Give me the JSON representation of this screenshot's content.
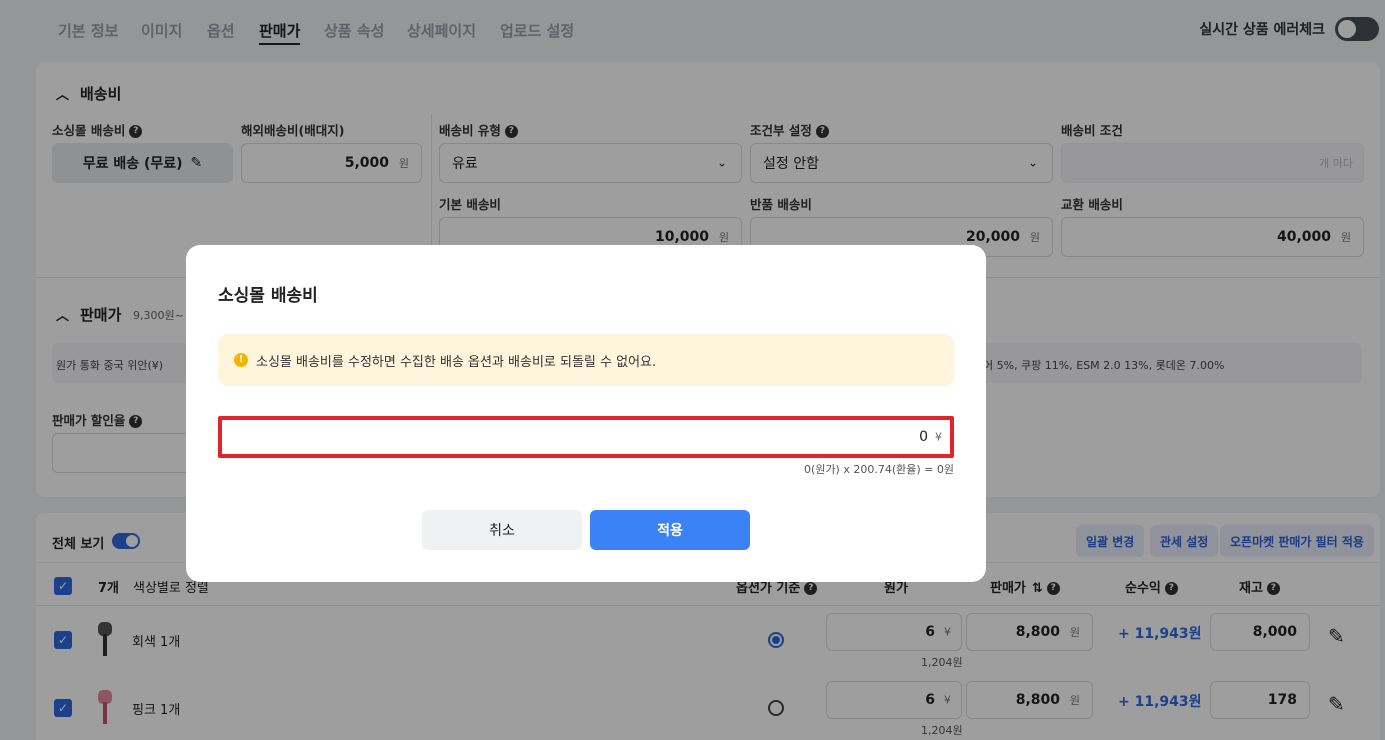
{
  "tabs": [
    "기본 정보",
    "이미지",
    "옵션",
    "판매가",
    "상품 속성",
    "상세페이지",
    "업로드 설정"
  ],
  "active_tab": "판매가",
  "realtime_check": {
    "label": "실시간 상품 에러체크",
    "enabled": false
  },
  "shipping": {
    "title": "배송비",
    "sourcing_fee_label": "소싱몰 배송비",
    "sourcing_fee_value": "무료 배송 (무료)",
    "overseas_label": "해외배송비(배대지)",
    "overseas_value": "5,000",
    "type_label": "배송비 유형",
    "type_value": "유료",
    "conditional_label": "조건부 설정",
    "conditional_value": "설정 안함",
    "condition_label": "배송비 조건",
    "condition_placeholder": "개 마다",
    "base_label": "기본 배송비",
    "base_value": "10,000",
    "return_label": "반품 배송비",
    "return_value": "20,000",
    "exchange_label": "교환 배송비",
    "exchange_value": "40,000",
    "unit": "원"
  },
  "price": {
    "title": "판매가",
    "range": "9,300원~",
    "currency_label": "원가 통화 중국 위안(¥)",
    "fees_text": "어 5%, 쿠팡 11%, ESM 2.0 13%, 롯데온 7.00%",
    "discount_label": "판매가 할인율"
  },
  "list": {
    "view_all_label": "전체 보기",
    "count": "7개",
    "sort_label": "색상별로 정렬",
    "buttons": [
      "일괄 변경",
      "관세 설정",
      "오픈마켓 판매가 필터 적용"
    ],
    "headers": {
      "base_option": "옵션가 기준",
      "cost": "원가",
      "price": "판매가",
      "profit": "순수익",
      "stock": "재고"
    },
    "rows": [
      {
        "name": "회색 1개",
        "cost": "6",
        "cost_krw": "1,204원",
        "price": "8,800",
        "profit": "+ 11,943원",
        "stock": "8,000",
        "base": true
      },
      {
        "name": "핑크 1개",
        "cost": "6",
        "cost_krw": "1,204원",
        "price": "8,800",
        "profit": "+ 11,943원",
        "stock": "178",
        "base": false
      }
    ],
    "yen": "¥",
    "won": "원"
  },
  "modal": {
    "title": "소싱몰 배송비",
    "warning": "소싱몰 배송비를 수정하면 수집한 배송 옵션과 배송비로 되돌릴 수 없어요.",
    "input_value": "0",
    "input_unit": "¥",
    "formula": "0(원가) x 200.74(환율) = 0원",
    "cancel_label": "취소",
    "apply_label": "적용"
  },
  "colors": {
    "accent": "#3b82f6",
    "highlight": "#e0242c",
    "warning_bg": "#fff4dc"
  }
}
